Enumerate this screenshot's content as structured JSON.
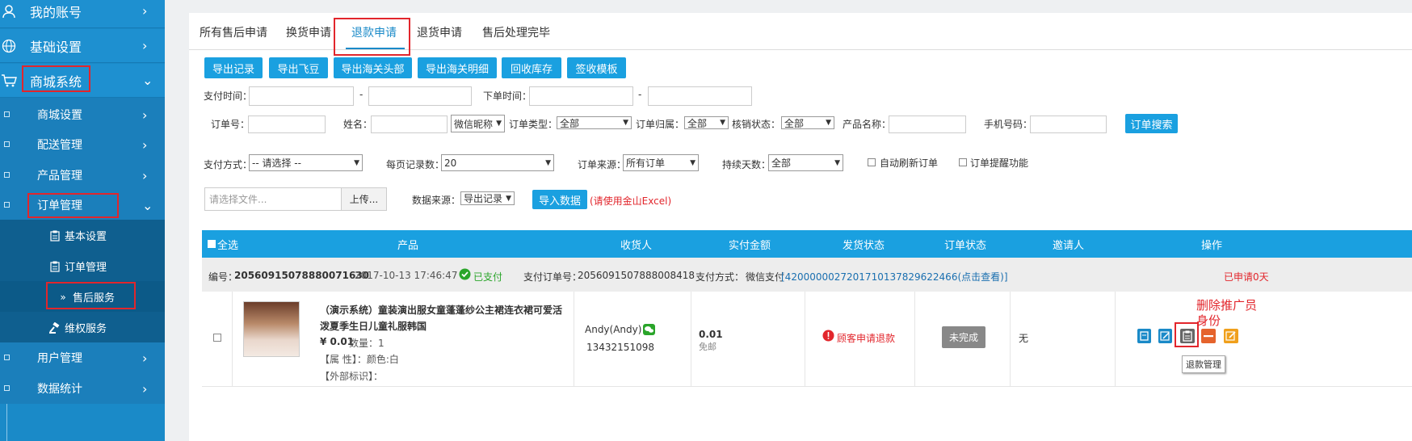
{
  "sidebar": {
    "items": [
      {
        "label": "我的账号",
        "icon": "user-icon"
      },
      {
        "label": "基础设置",
        "icon": "globe-icon"
      },
      {
        "label": "商城系统",
        "icon": "cart-icon"
      },
      {
        "label": "商城设置"
      },
      {
        "label": "配送管理"
      },
      {
        "label": "产品管理"
      },
      {
        "label": "订单管理"
      },
      {
        "label": "基本设置",
        "icon": "clipboard-icon"
      },
      {
        "label": "订单管理",
        "icon": "clipboard-icon"
      },
      {
        "label": "售后服务",
        "icon": "double-chevron-icon"
      },
      {
        "label": "维权服务",
        "icon": "gavel-icon"
      },
      {
        "label": "用户管理"
      },
      {
        "label": "数据统计"
      }
    ]
  },
  "tabs": [
    "所有售后申请",
    "换货申请",
    "退款申请",
    "退货申请",
    "售后处理完毕"
  ],
  "toolbar": [
    "导出记录",
    "导出飞豆",
    "导出海关头部",
    "导出海关明细",
    "回收库存",
    "签收模板"
  ],
  "filters": {
    "pay_time": "支付时间：",
    "dash": "-",
    "order_time": "下单时间：",
    "order_no": "订单号：",
    "name": "姓名：",
    "wechat_nick": "微信昵称",
    "order_type": "订单类型：",
    "order_type_val": "全部",
    "order_belong": "订单归属：",
    "order_belong_val": "全部",
    "verify_status": "核销状态：",
    "verify_status_val": "全部",
    "product_name": "产品名称：",
    "phone": "手机号码：",
    "search_btn": "订单搜索",
    "pay_method": "支付方式：",
    "pay_method_val": "-- 请选择 --",
    "per_page": "每页记录数：",
    "per_page_val": "20",
    "order_source": "订单来源：",
    "order_source_val": "所有订单",
    "duration": "持续天数：",
    "duration_val": "全部",
    "auto_refresh": "自动刷新订单",
    "order_remind": "订单提醒功能",
    "file_placeholder": "请选择文件...",
    "upload": "上传...",
    "data_source": "数据来源：",
    "data_source_val": "导出记录",
    "import_btn": "导入数据",
    "import_note": "(请使用金山Excel)"
  },
  "table": {
    "headers": [
      "全选",
      "产品",
      "收货人",
      "实付金额",
      "发货状态",
      "订单状态",
      "邀请人",
      "操作"
    ]
  },
  "order": {
    "id_label": "编号：",
    "id": "20560915078880071630",
    "time": "2017-10-13 17:46:47",
    "paid": "已支付",
    "pay_no_label": "支付订单号：",
    "pay_no": "2056091507888008418",
    "pay_method_label": "支付方式：",
    "pay_method": "微信支付",
    "txn": "[4200000027201710137829622466(点击查看)]",
    "applied": "已申请0天",
    "product_title_1": "（演示系统）童装演出服女童蓬蓬纱公主裙连衣裙可爱活",
    "product_title_2": "泼夏季生日儿童礼服韩国",
    "price": "¥ 0.01",
    "qty": "数量：1",
    "attr": "【属 性】：颜色:白",
    "external": "【外部标识】：",
    "buyer": "Andy(Andy)",
    "phone": "13432151098",
    "amount": "0.01",
    "shipping": "免邮",
    "ship_status": "顾客申请退款",
    "order_status": "未完成",
    "inviter": "无"
  },
  "annotation": "删除推广员身份",
  "tooltip": "退款管理",
  "colors": {
    "accent": "#1aa0e0",
    "sidebar": "#1a8ac8",
    "highlight": "#e2262c",
    "paid": "#2aa52a"
  }
}
